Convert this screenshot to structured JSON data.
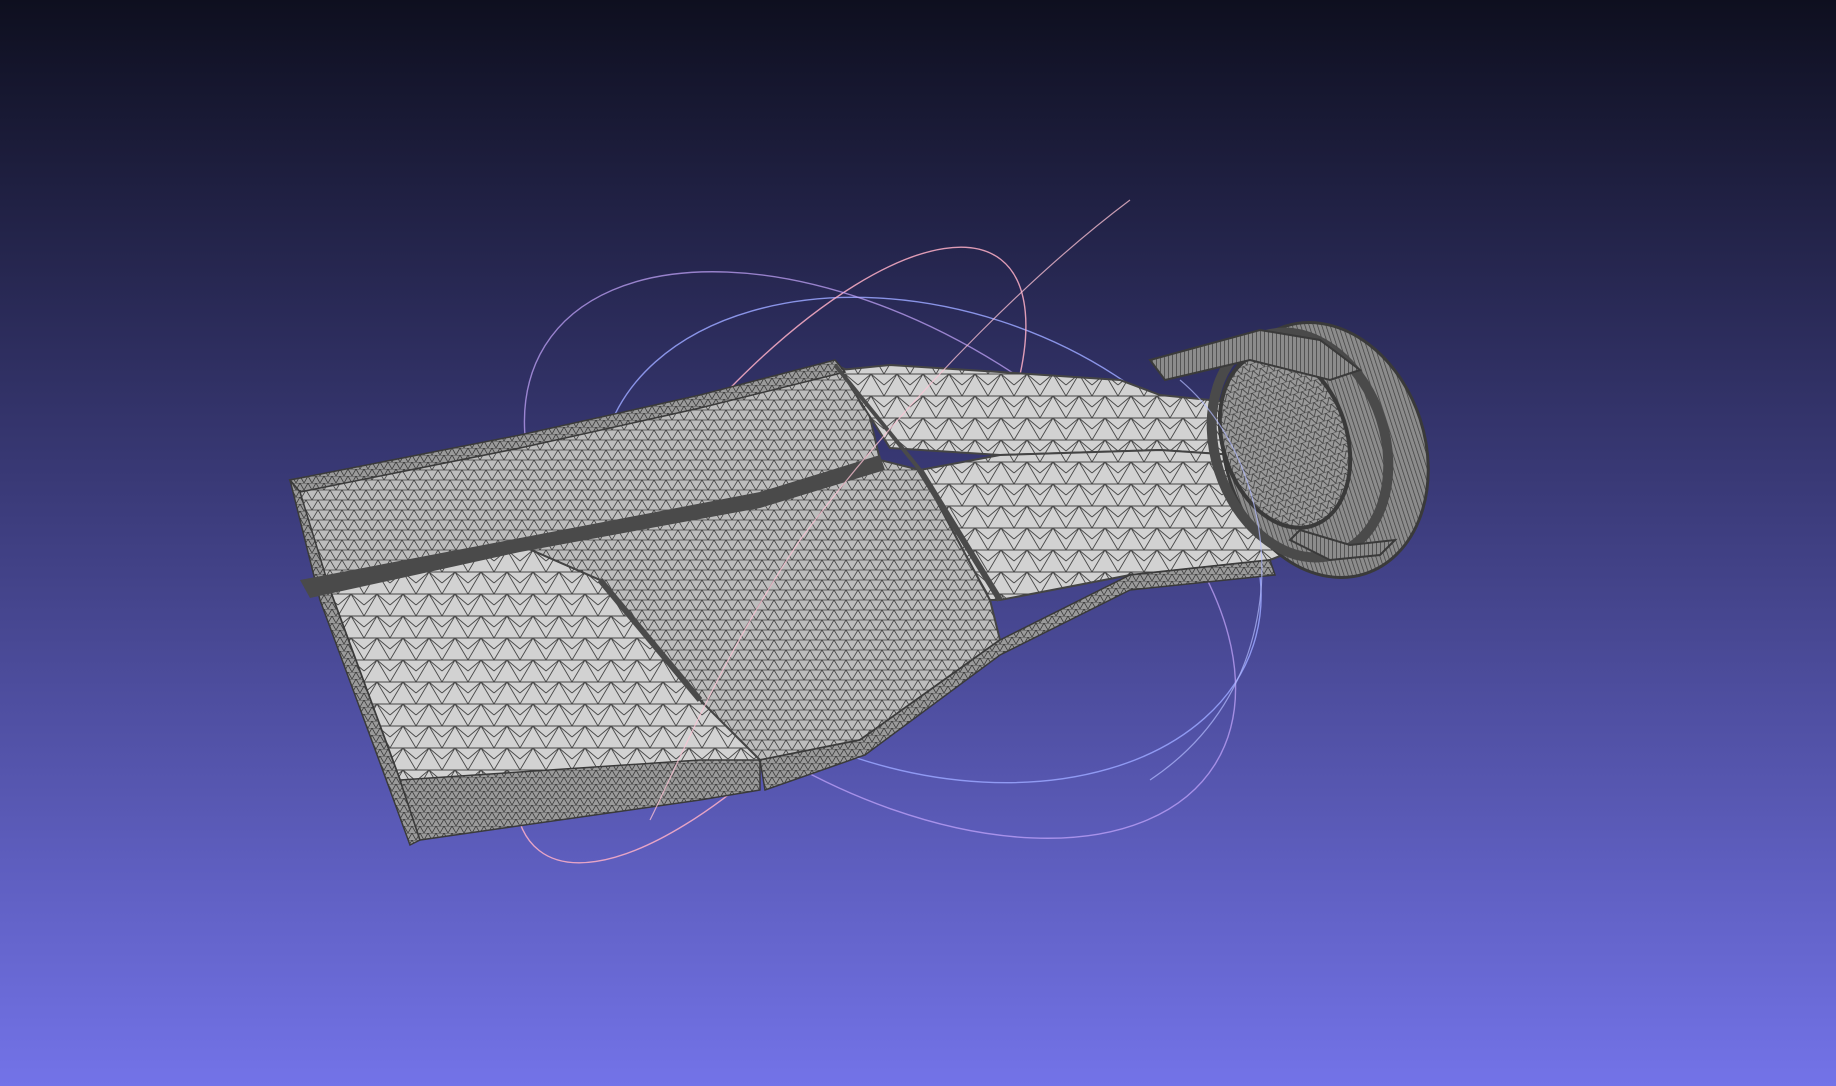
{
  "viewport": {
    "background_top": "#0e0f1f",
    "background_mid": "#3a3a78",
    "background_bottom": "#7373e8",
    "mesh_fill": "#cfcfcf",
    "mesh_fill_shadow": "#a9a9a9",
    "mesh_wire": "#3d3d3d",
    "mesh_edge_dark": "#444444",
    "trackball_blue": "#9aa6ff",
    "trackball_pink": "#ffb0c8",
    "trackball_purple": "#c8a8ff"
  },
  "model": {
    "name": "duct-mesh",
    "render_mode": "wireframe-on-flat"
  },
  "trackball": {
    "visible": true
  }
}
